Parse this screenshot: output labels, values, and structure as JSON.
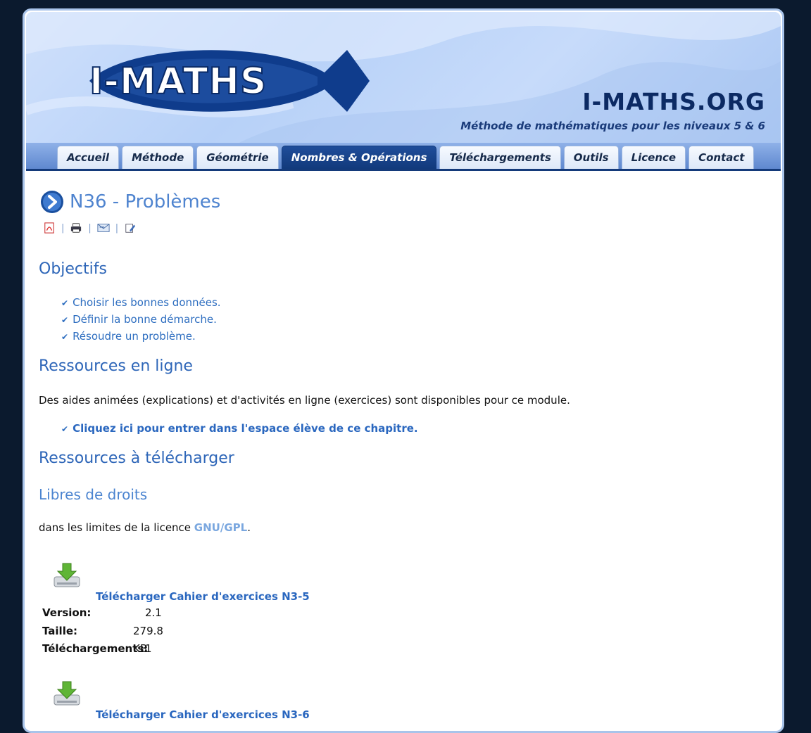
{
  "site": {
    "logo_text": "I-MATHS",
    "name": "I-MATHS.ORG",
    "tagline": "Méthode de mathématiques pour les niveaux 5 & 6"
  },
  "nav": {
    "tabs": [
      {
        "label": "Accueil"
      },
      {
        "label": "Méthode"
      },
      {
        "label": "Géométrie"
      },
      {
        "label": "Nombres & Opérations",
        "active": true
      },
      {
        "label": "Téléchargements"
      },
      {
        "label": "Outils"
      },
      {
        "label": "Licence"
      },
      {
        "label": "Contact"
      }
    ]
  },
  "page": {
    "title": "N36 - Problèmes",
    "toolbar_icons": [
      "pdf-icon",
      "print-icon",
      "email-icon",
      "edit-icon"
    ]
  },
  "objectifs": {
    "heading": "Objectifs",
    "items": [
      "Choisir les bonnes données.",
      "Définir la bonne démarche.",
      "Résoudre un problème."
    ]
  },
  "ressources_en_ligne": {
    "heading": "Ressources en ligne",
    "text": "Des aides animées (explications) et d'activités en ligne (exercices) sont disponibles pour ce module.",
    "link": "Cliquez ici pour entrer dans l'espace élève de ce chapitre."
  },
  "ressources_telecharger": {
    "heading": "Ressources à télécharger",
    "subheading": "Libres de droits",
    "license_text": "dans les limites de la licence ",
    "license_link": "GNU/GPL",
    "license_end": "."
  },
  "downloads": [
    {
      "link": "Télécharger Cahier d'exercices N3-5",
      "version_label": "Version:",
      "version": "2.1",
      "size_label": "Taille:",
      "size": "279.8 KB",
      "count_label": "Téléchargements:",
      "count": "1"
    },
    {
      "link": "Télécharger Cahier d'exercices N3-6"
    }
  ],
  "colors": {
    "accent": "#2e66b8",
    "nav_active": "#123a7c",
    "background": "#0b1a2e"
  }
}
